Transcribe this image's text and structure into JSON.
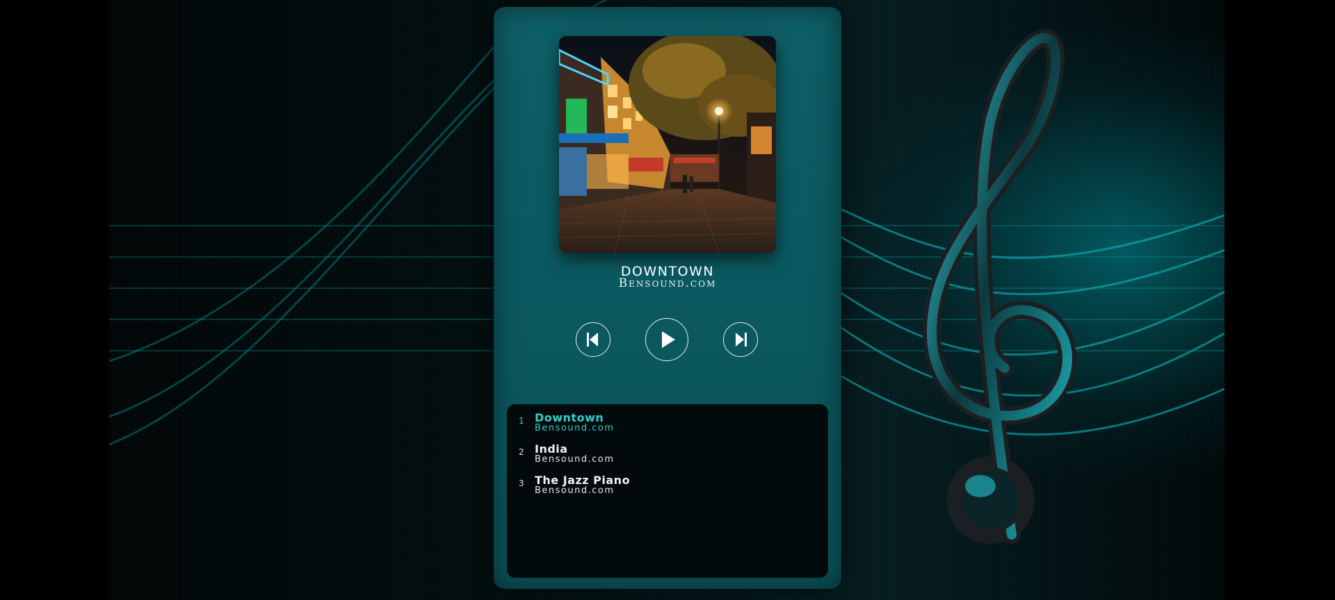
{
  "player": {
    "now_playing": {
      "title": "DOWNTOWN",
      "artist": "Bensound.com"
    },
    "controls": {
      "prev_icon": "skip-previous-icon",
      "play_icon": "play-icon",
      "next_icon": "skip-next-icon"
    },
    "playlist": [
      {
        "number": "1",
        "title": "Downtown",
        "artist": "Bensound.com",
        "active": true
      },
      {
        "number": "2",
        "title": "India",
        "artist": "Bensound.com",
        "active": false
      },
      {
        "number": "3",
        "title": "The Jazz Piano",
        "artist": "Bensound.com",
        "active": false
      }
    ]
  },
  "colors": {
    "panel": "#0b5a61",
    "accent": "#2fcfcf",
    "playlist_bg": "#030a0b",
    "background": "#000000"
  }
}
